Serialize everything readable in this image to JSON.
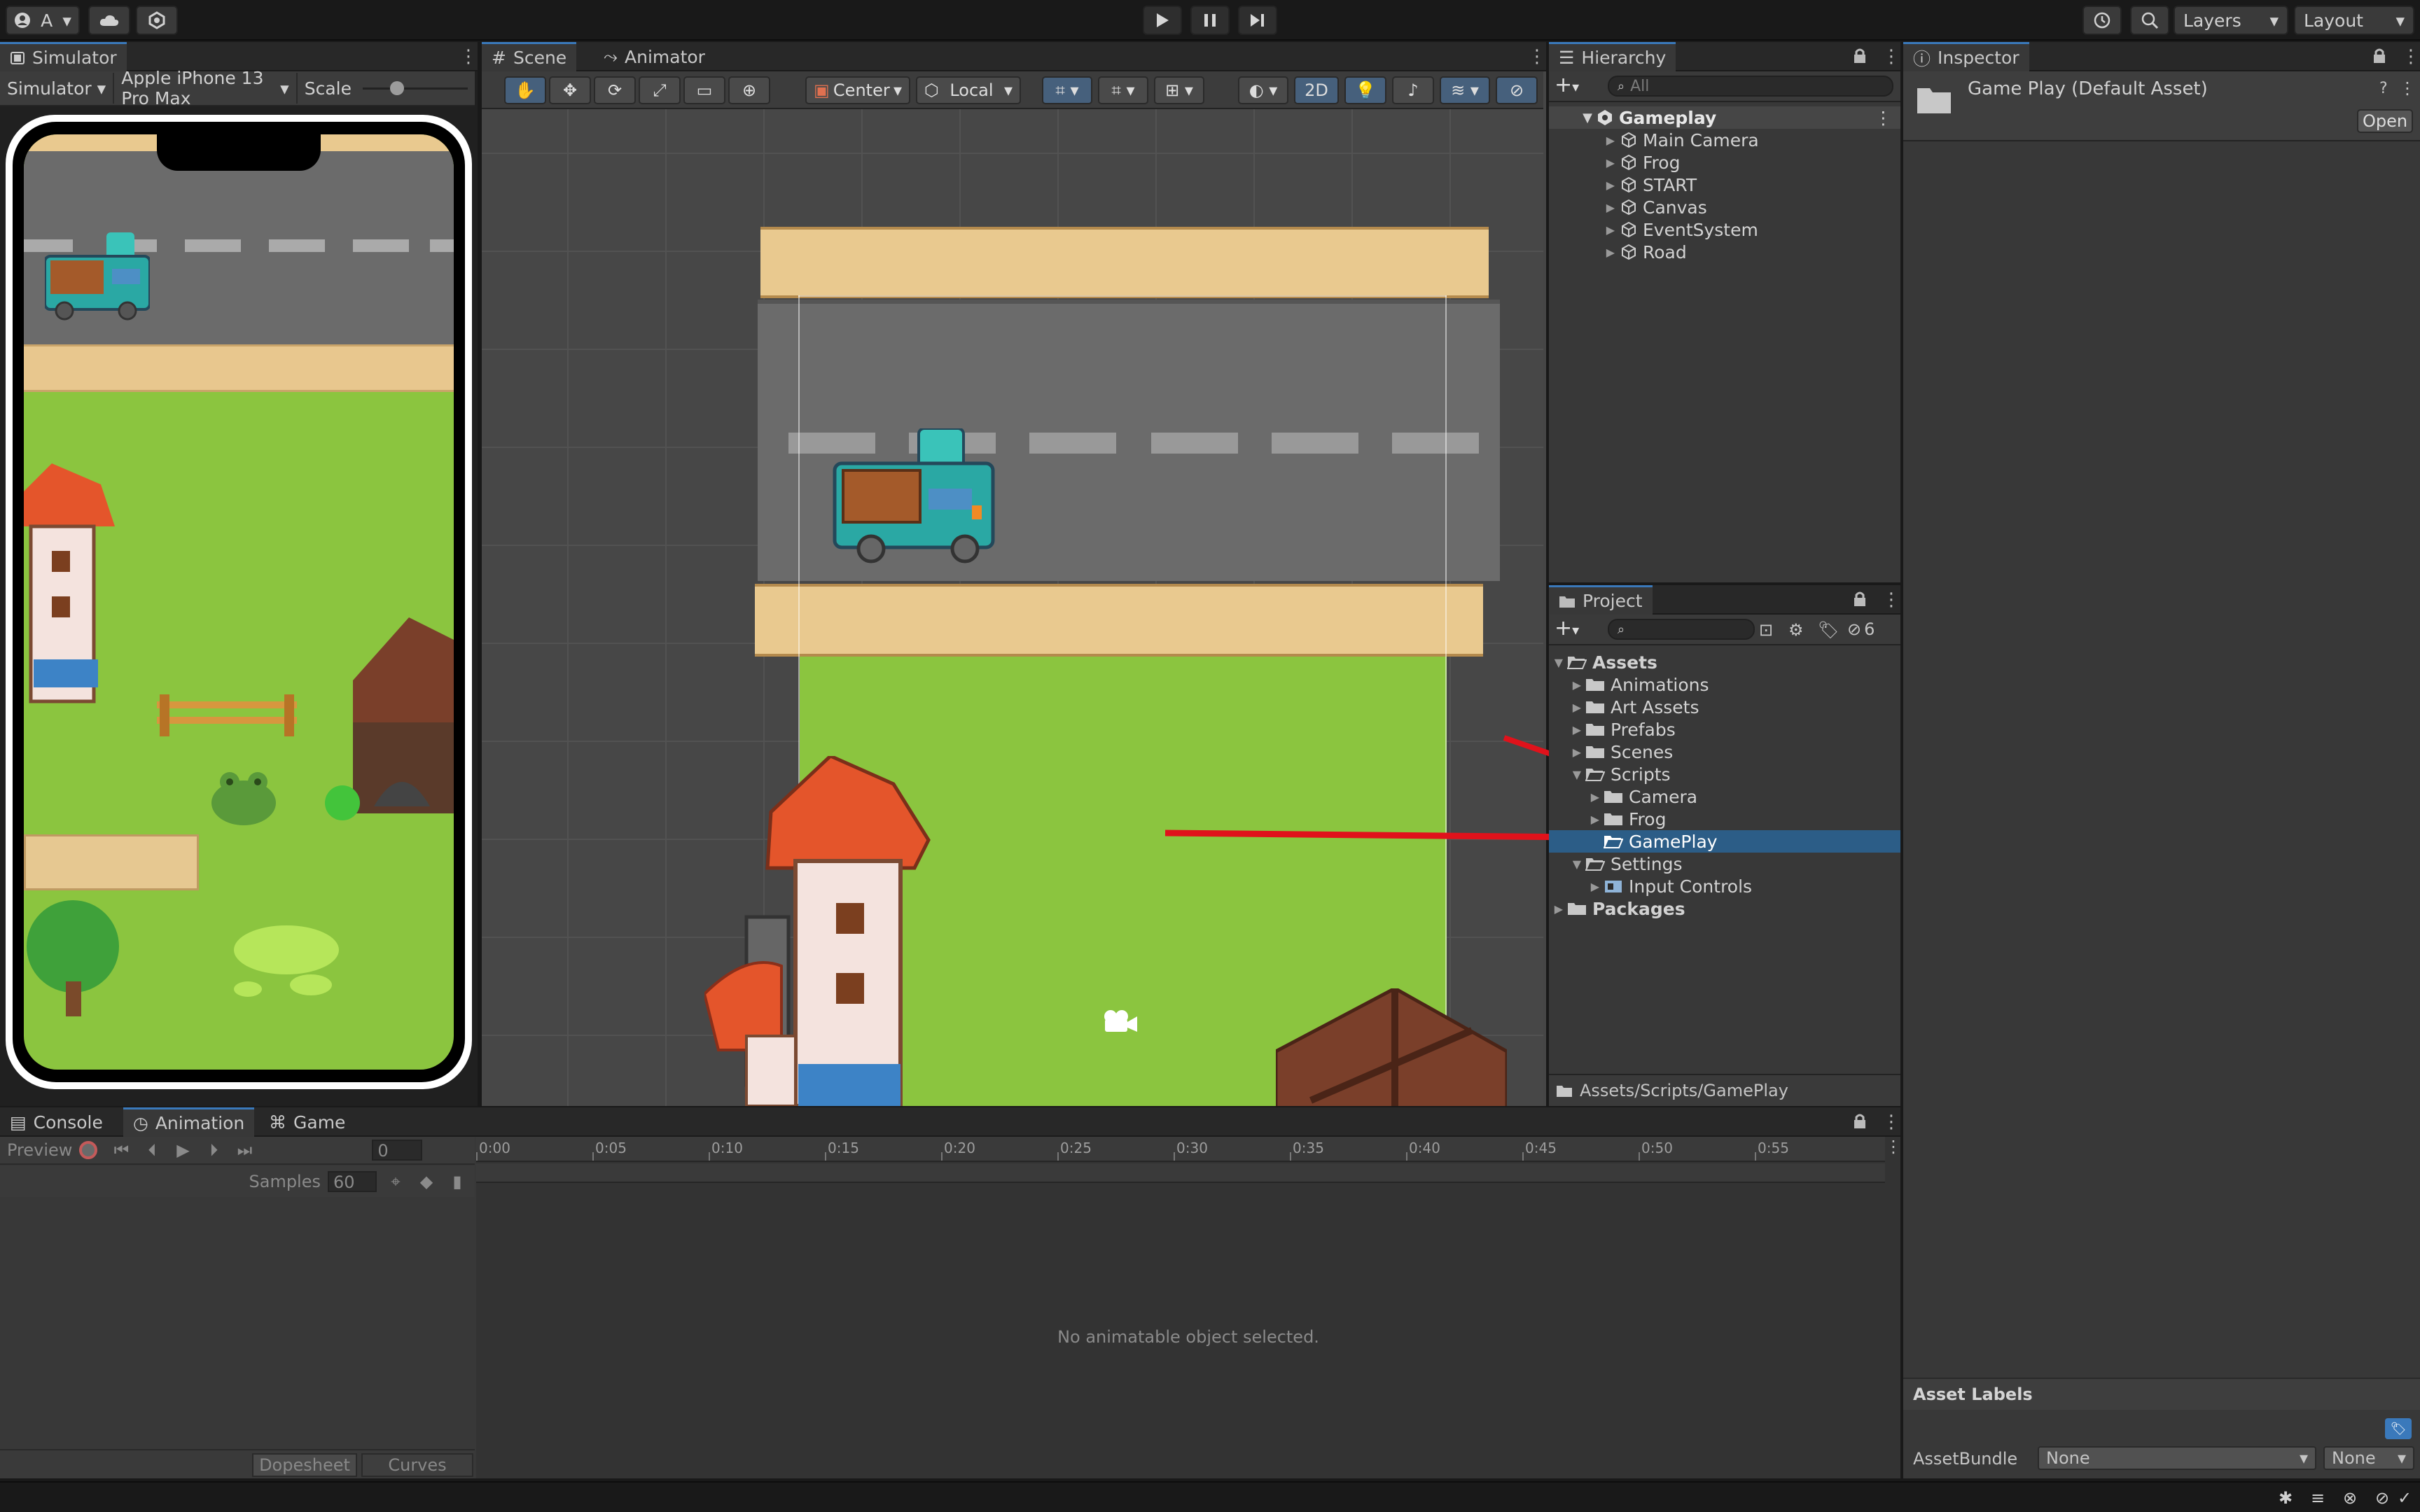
{
  "topbar": {
    "account_label": "A",
    "layers_label": "Layers",
    "layout_label": "Layout"
  },
  "simulator": {
    "tab_label": "Simulator",
    "mode_label": "Simulator",
    "device_label": "Apple iPhone 13 Pro Max",
    "scale_label": "Scale",
    "scale_value": 0.3
  },
  "scene": {
    "tab_label": "Scene",
    "animator_tab_label": "Animator",
    "pivot_label": "Center",
    "space_label": "Local",
    "mode_2d_label": "2D"
  },
  "hierarchy": {
    "tab_label": "Hierarchy",
    "search_placeholder": "All",
    "root": "Gameplay",
    "items": [
      {
        "label": "Main Camera"
      },
      {
        "label": "Frog"
      },
      {
        "label": "START"
      },
      {
        "label": "Canvas"
      },
      {
        "label": "EventSystem"
      },
      {
        "label": "Road"
      }
    ]
  },
  "project": {
    "tab_label": "Project",
    "hidden_count": "6",
    "tree": [
      {
        "label": "Assets",
        "bold": true
      },
      {
        "label": "Animations"
      },
      {
        "label": "Art Assets"
      },
      {
        "label": "Prefabs"
      },
      {
        "label": "Scenes"
      },
      {
        "label": "Scripts"
      },
      {
        "label": "Camera"
      },
      {
        "label": "Frog"
      },
      {
        "label": "GamePlay"
      },
      {
        "label": "Settings"
      },
      {
        "label": "Input Controls"
      },
      {
        "label": "Packages",
        "bold": true
      }
    ],
    "path": "Assets/Scripts/GamePlay"
  },
  "inspector": {
    "tab_label": "Inspector",
    "title": "Game Play (Default Asset)",
    "open_label": "Open",
    "asset_labels_title": "Asset Labels",
    "assetbundle_label": "AssetBundle",
    "assetbundle_value": "None",
    "variant_value": "None"
  },
  "bottom": {
    "console_tab": "Console",
    "animation_tab": "Animation",
    "game_tab": "Game",
    "preview_label": "Preview",
    "frame_value": "0",
    "samples_label": "Samples",
    "samples_value": "60",
    "ruler": [
      "0:00",
      "0:05",
      "0:10",
      "0:15",
      "0:20",
      "0:25",
      "0:30",
      "0:35",
      "0:40",
      "0:45",
      "0:50",
      "0:55"
    ],
    "empty_message": "No animatable object selected.",
    "dopesheet_label": "Dopesheet",
    "curves_label": "Curves"
  },
  "colors": {
    "accent": "#3a79bb",
    "selection": "#2c5d87",
    "grass": "#8bc53f",
    "road": "#6b6b6b",
    "arrow": "#e0121b"
  }
}
